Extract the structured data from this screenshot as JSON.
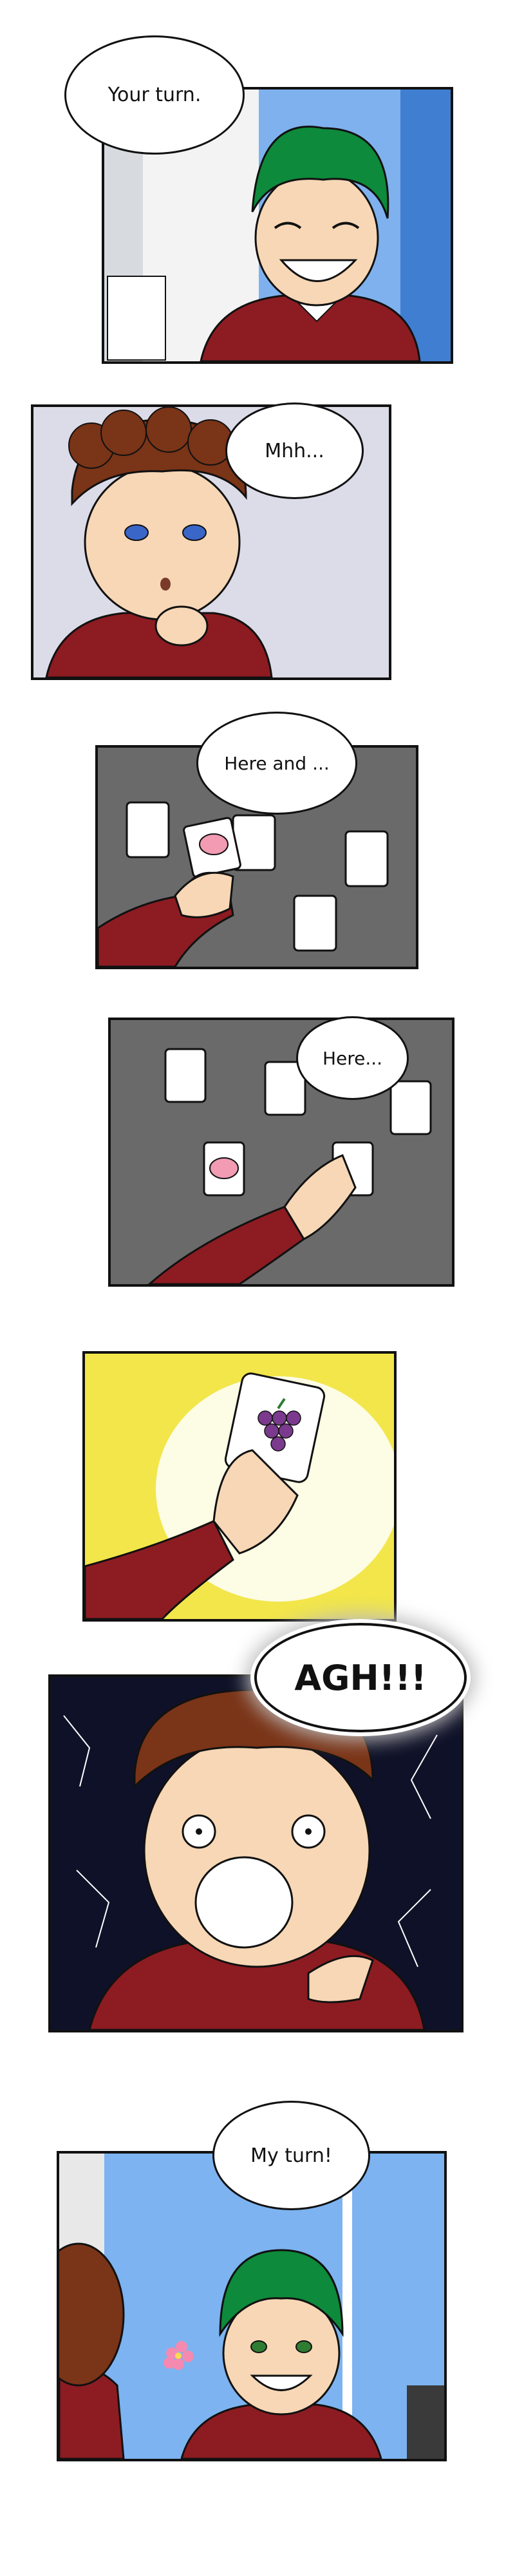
{
  "comic": {
    "panels": [
      {
        "id": 1,
        "speech": "Your turn."
      },
      {
        "id": 2,
        "speech": "Mhh..."
      },
      {
        "id": 3,
        "speech": "Here and ..."
      },
      {
        "id": 4,
        "speech": "Here..."
      },
      {
        "id": 5,
        "speech": ""
      },
      {
        "id": 6,
        "speech": "AGH!!!"
      },
      {
        "id": 7,
        "speech": "My turn!"
      }
    ]
  },
  "colors": {
    "sweater": "#8d1c22",
    "green_hair": "#0d8a3b",
    "brown_hair": "#7a3417",
    "table": "#6a6a6a",
    "sky": "#7db3f0",
    "burst_yellow": "#f2e64a",
    "night": "#0f1128"
  },
  "icons": [
    "pig-card-icon",
    "grape-card-icon",
    "flower-icon"
  ]
}
